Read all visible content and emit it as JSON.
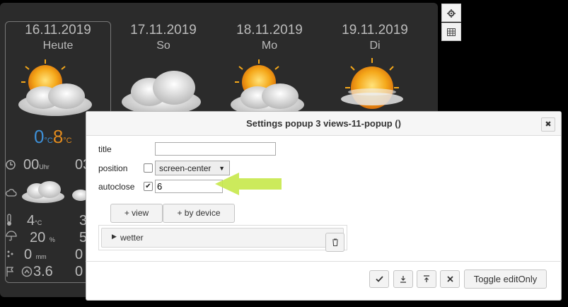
{
  "forecast": {
    "days": [
      {
        "date": "16.11.2019",
        "name": "Heute",
        "icon": "partly-cloudy-icon"
      },
      {
        "date": "17.11.2019",
        "name": "So",
        "icon": "cloudy-icon"
      },
      {
        "date": "18.11.2019",
        "name": "Mo",
        "icon": "partly-cloudy-icon"
      },
      {
        "date": "19.11.2019",
        "name": "Di",
        "icon": "sunny-haze-icon"
      }
    ],
    "today_detail": {
      "temp_min": "0",
      "temp_min_unit": "°C",
      "temp_max": "8",
      "temp_max_unit": "°C",
      "time": "00",
      "time_unit": "Uhr",
      "temp": "4",
      "temp_unit": "°C",
      "rain_prob": "20",
      "rain_prob_unit": "%",
      "rain_amount": "0",
      "rain_amount_unit": "mm",
      "wind": "3.6"
    },
    "second_col": {
      "time": "03",
      "temp": "3",
      "rain_prob": "5",
      "rain_amount": "0",
      "wind": "0"
    }
  },
  "side_buttons": {
    "settings_icon": "gear-icon",
    "grid_icon": "grid-icon"
  },
  "dialog": {
    "title": "Settings popup 3 views-11-popup ()",
    "close_label": "✖",
    "labels": {
      "title": "title",
      "position": "position",
      "autoclose": "autoclose"
    },
    "title_value": "",
    "position_checked": false,
    "position_value": "screen-center",
    "autoclose_checked": true,
    "autoclose_value": "6",
    "view_button": "+ view",
    "device_button": "+ by device",
    "tree_item": "wetter",
    "footer": {
      "ok_icon": "check-icon",
      "download_icon": "download-icon",
      "upload_icon": "upload-icon",
      "cancel_icon": "cancel-icon",
      "toggle_label": "Toggle editOnly"
    }
  }
}
